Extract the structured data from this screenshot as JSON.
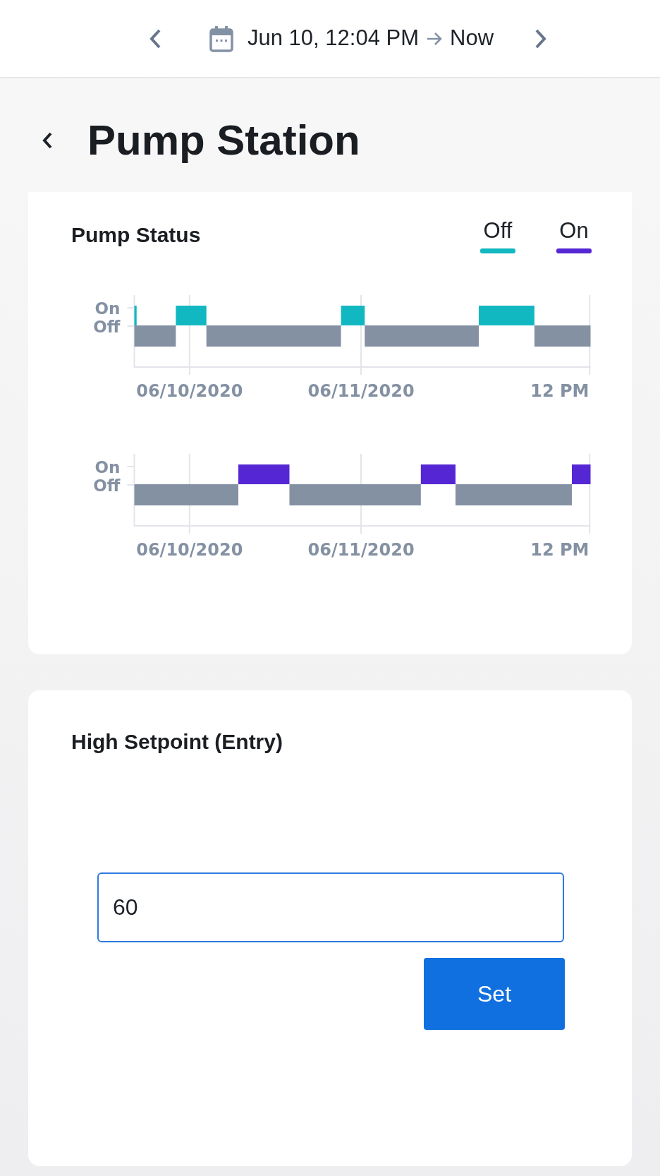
{
  "date_range": {
    "start": "Jun 10, 12:04 PM",
    "end": "Now"
  },
  "page_title": "Pump Station",
  "status_card": {
    "title": "Pump Status",
    "legend": [
      {
        "label": "Off",
        "color": "#12b8c1"
      },
      {
        "label": "On",
        "color": "#5527d4"
      }
    ],
    "charts": [
      {
        "y_labels": [
          "On",
          "Off"
        ],
        "x_labels": [
          "06/10/2020",
          "06/11/2020",
          "12 PM"
        ]
      },
      {
        "y_labels": [
          "On",
          "Off"
        ],
        "x_labels": [
          "06/10/2020",
          "06/11/2020",
          "12 PM"
        ]
      }
    ]
  },
  "setpoint_card": {
    "title": "High Setpoint (Entry)",
    "value": "60",
    "button": "Set"
  }
}
